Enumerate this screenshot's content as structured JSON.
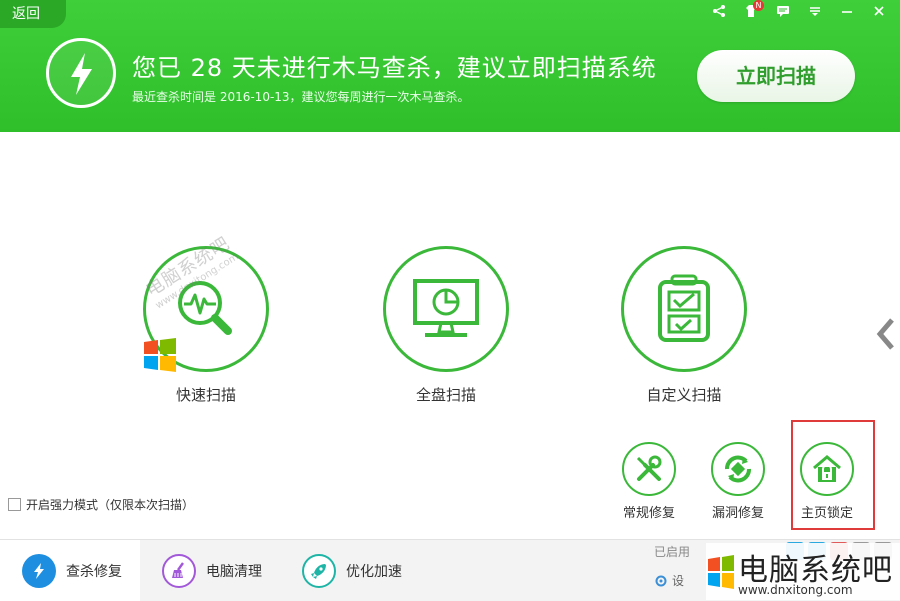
{
  "header": {
    "back_label": "返回",
    "title": "您已 28 天未进行木马查杀，建议立即扫描系统",
    "subtitle": "最近查杀时间是 2016-10-13，建议您每周进行一次木马查杀。",
    "scan_button_label": "立即扫描",
    "badge": "N",
    "window_icons": [
      "share-icon",
      "skin-icon",
      "message-icon",
      "menu-icon",
      "minimize-icon",
      "close-icon"
    ]
  },
  "scan_modes": [
    {
      "label": "快速扫描",
      "icon": "magnifier-pulse-icon"
    },
    {
      "label": "全盘扫描",
      "icon": "monitor-icon"
    },
    {
      "label": "自定义扫描",
      "icon": "checklist-icon"
    }
  ],
  "tools": [
    {
      "label": "常规修复",
      "icon": "wrench-screwdriver-icon"
    },
    {
      "label": "漏洞修复",
      "icon": "patch-repair-icon"
    },
    {
      "label": "主页锁定",
      "icon": "home-lock-icon"
    }
  ],
  "strong_mode_label": "开启强力模式（仅限本次扫描）",
  "bottom_nav": [
    {
      "label": "查杀修复",
      "icon": "bolt-icon",
      "color": "#1e8fe0",
      "active": true
    },
    {
      "label": "电脑清理",
      "icon": "broom-icon",
      "color": "#a259d9",
      "active": false
    },
    {
      "label": "优化加速",
      "icon": "rocket-icon",
      "color": "#1fb5a6",
      "active": false
    }
  ],
  "bottom_right": {
    "enabled_text": "已启用",
    "settings_label": "设"
  },
  "watermark": {
    "center_text": "电脑系统吧",
    "center_url": "www.dnxitong.com",
    "corner_text": "电脑系统吧",
    "corner_url": "www.dnxitong.com"
  },
  "colors": {
    "brand_green": "#2fbf2b",
    "circle_green": "#3bb83a",
    "highlight_red": "#e03b3b"
  }
}
